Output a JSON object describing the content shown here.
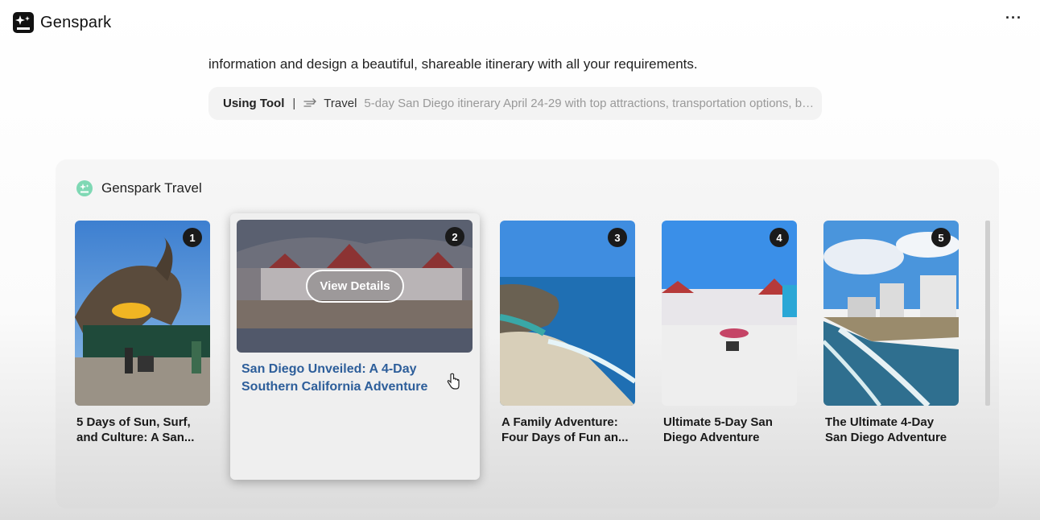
{
  "app": {
    "brand": "Genspark",
    "more_icon": "more-horizontal-icon"
  },
  "intro_text": "information and design a beautiful, shareable itinerary with all your requirements.",
  "tool_call": {
    "label": "Using Tool",
    "separator": "|",
    "tool_icon": "travel-icon",
    "tool_name": "Travel",
    "query": "5-day San Diego itinerary April 24-29 with top attractions, transportation options, bea..."
  },
  "panel": {
    "title": "Genspark Travel",
    "icon": "genspark-travel-icon",
    "view_details_label": "View Details",
    "cards": [
      {
        "number": "1",
        "title": "5 Days of Sun, Surf, and Culture: A San...",
        "image": "san-diego-zoo-elephant-statue"
      },
      {
        "number": "2",
        "title": "San Diego Unveiled: A 4-Day Southern California Adventure",
        "image": "hotel-del-coronado-beach",
        "active": true
      },
      {
        "number": "3",
        "title": "A Family Adventure: Four Days of Fun an...",
        "image": "la-jolla-cove-coast"
      },
      {
        "number": "4",
        "title": "Ultimate 5-Day San Diego Adventure",
        "image": "coronado-beach-umbrellas"
      },
      {
        "number": "5",
        "title": "The Ultimate 4-Day San Diego Adventure",
        "image": "coastline-highrise-beach"
      }
    ]
  },
  "colors": {
    "active_title": "#2d5e9a",
    "badge_bg": "#1a1a1a",
    "travel_icon": "#7fd8b4"
  }
}
